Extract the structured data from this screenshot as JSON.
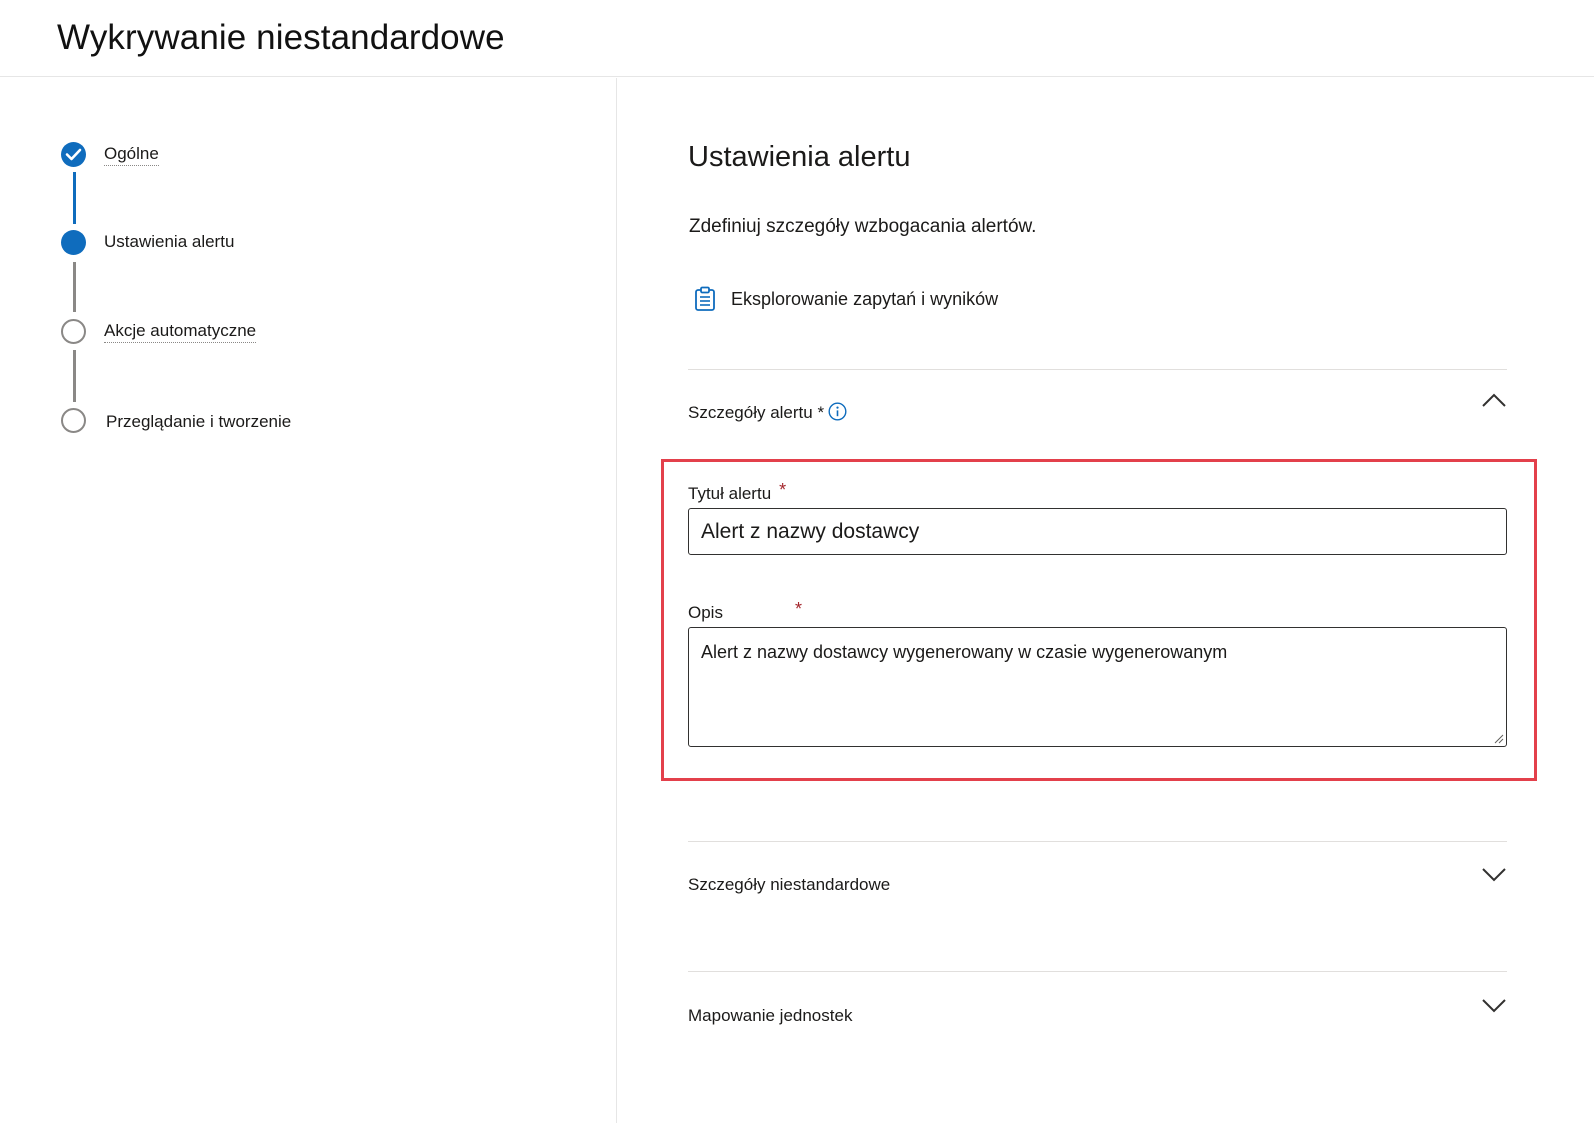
{
  "header": {
    "title": "Wykrywanie niestandardowe"
  },
  "stepper": {
    "steps": [
      {
        "label": "Ogólne",
        "state": "completed"
      },
      {
        "label": "Ustawienia alertu",
        "state": "current"
      },
      {
        "label": "Akcje automatyczne",
        "state": "upcoming"
      },
      {
        "label": "Przeglądanie i tworzenie",
        "state": "upcoming"
      }
    ]
  },
  "main": {
    "title": "Ustawienia alertu",
    "description": "Zdefiniuj szczegóły wzbogacania alertów.",
    "explore_link": {
      "label": "Eksplorowanie zapytań i wyników",
      "icon": "clipboard-icon"
    },
    "alert_details": {
      "label": "Szczegóły alertu",
      "required_marker": "*",
      "expanded": true,
      "title_field": {
        "label": "Tytuł alertu",
        "required_marker": "*",
        "value": "Alert z nazwy dostawcy"
      },
      "description_field": {
        "label": "Opis",
        "required_marker": "*",
        "value": "Alert z nazwy dostawcy wygenerowany w czasie wygenerowanym"
      }
    },
    "custom_details": {
      "label": "Szczegóły niestandardowe",
      "expanded": false
    },
    "entity_mapping": {
      "label": "Mapowanie jednostek",
      "expanded": false
    }
  },
  "colors": {
    "accent": "#0f6cbd",
    "required": "#a4262c",
    "highlight_border": "#e3404b",
    "upcoming_step": "#8a8886"
  }
}
